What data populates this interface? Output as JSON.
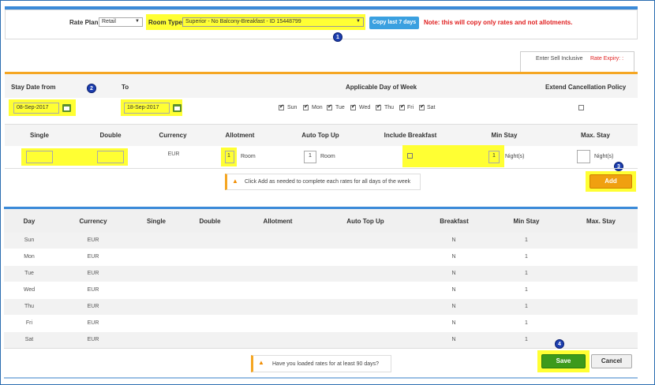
{
  "top": {
    "rate_plan_label": "Rate Plan",
    "rate_plan_value": "Retail",
    "room_type_label": "Room Type",
    "room_type_value": "Superior - No Balcony-Breakfast - ID 15448799",
    "copy_button": "Copy last 7 days",
    "note": "Note: this will copy only rates and not allotments."
  },
  "tabs": {
    "sell_inclusive": "Enter Sell Inclusive",
    "rate_expiry": "Rate Expiry: :"
  },
  "dates": {
    "stay_from_label": "Stay Date from",
    "to_label": "To",
    "from_value": "08-Sep-2017",
    "to_value": "18-Sep-2017",
    "applicable_label": "Applicable Day of Week",
    "extend_label": "Extend Cancellation Policy",
    "days": [
      "Sun",
      "Mon",
      "Tue",
      "Wed",
      "Thu",
      "Fri",
      "Sat"
    ]
  },
  "entry": {
    "headers": [
      "Single",
      "Double",
      "Currency",
      "Allotment",
      "Auto Top Up",
      "Include Breakfast",
      "Min Stay",
      "Max. Stay"
    ],
    "currency": "EUR",
    "allotment_value": "1",
    "allotment_unit": "Room",
    "auto_top_up_value": "1",
    "auto_top_up_unit": "Room",
    "min_stay_value": "1",
    "night_unit": "Night(s)",
    "max_night_unit": "Night(s)",
    "hint": "Click Add as needed to complete each rates for all days of the week",
    "add_button": "Add"
  },
  "grid": {
    "headers": [
      "Day",
      "Currency",
      "Single",
      "Double",
      "Allotment",
      "Auto Top Up",
      "Breakfast",
      "Min Stay",
      "Max. Stay"
    ],
    "rows": [
      {
        "day": "Sun",
        "currency": "EUR",
        "breakfast": "N",
        "min_stay": "1"
      },
      {
        "day": "Mon",
        "currency": "EUR",
        "breakfast": "N",
        "min_stay": "1"
      },
      {
        "day": "Tue",
        "currency": "EUR",
        "breakfast": "N",
        "min_stay": "1"
      },
      {
        "day": "Wed",
        "currency": "EUR",
        "breakfast": "N",
        "min_stay": "1"
      },
      {
        "day": "Thu",
        "currency": "EUR",
        "breakfast": "N",
        "min_stay": "1"
      },
      {
        "day": "Fri",
        "currency": "EUR",
        "breakfast": "N",
        "min_stay": "1"
      },
      {
        "day": "Sat",
        "currency": "EUR",
        "breakfast": "N",
        "min_stay": "1"
      }
    ]
  },
  "footer": {
    "question": "Have you loaded rates for at least 90 days?",
    "save_button": "Save",
    "cancel_button": "Cancel"
  },
  "markers": [
    "1",
    "2",
    "3",
    "4"
  ],
  "colors": {
    "highlight": "#ffff33",
    "accent_blue": "#3b8ad8",
    "accent_orange": "#f5a623",
    "note_red": "#e02020",
    "save_green": "#3c9a1c",
    "marker": "#1d3fb0"
  }
}
